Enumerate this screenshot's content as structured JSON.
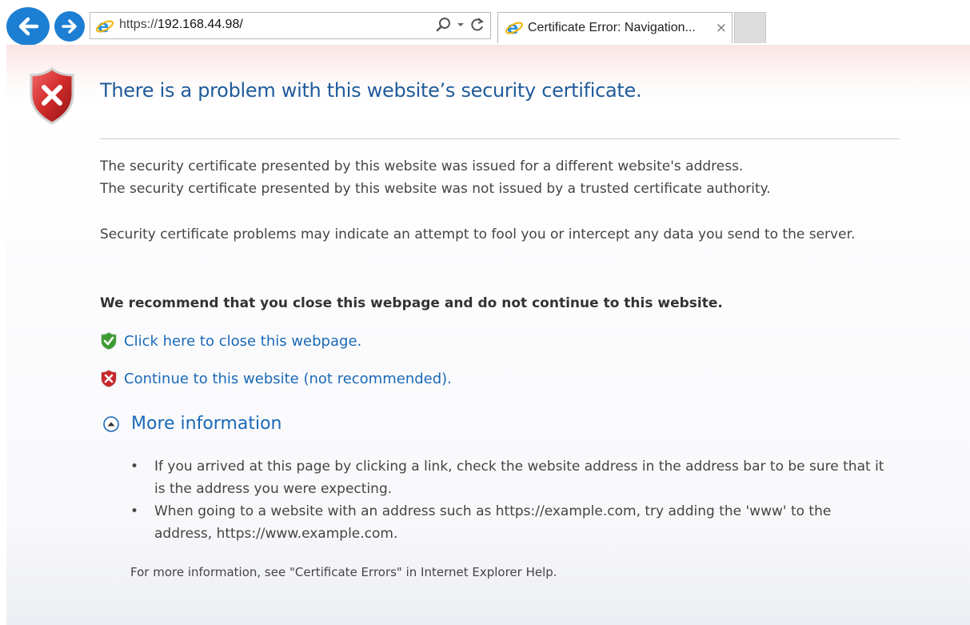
{
  "browser": {
    "url_prefix": "https://",
    "url_host": "192.168.44.98/",
    "tab_title": "Certificate Error: Navigation...",
    "close_glyph": "×"
  },
  "page": {
    "title": "There is a problem with this website’s security certificate.",
    "lines": [
      "The security certificate presented by this website was issued for a different website's address.",
      "The security certificate presented by this website was not issued by a trusted certificate authority."
    ],
    "warning": "Security certificate problems may indicate an attempt to fool you or intercept any data you send to the server.",
    "recommend": "We recommend that you close this webpage and do not continue to this website.",
    "close_link": "Click here to close this webpage.",
    "continue_link": "Continue to this website (not recommended).",
    "more_info": "More information",
    "bullets": [
      "If you arrived at this page by clicking a link, check the website address in the address bar to be sure that it is the address you were expecting.",
      "When going to a website with an address such as https://example.com, try adding the 'www' to the address, https://www.example.com."
    ],
    "bullet_glyph": "•",
    "help": "For more information, see \"Certificate Errors\" in Internet Explorer Help."
  },
  "colors": {
    "nav_blue": "#1d7fd3",
    "title_blue": "#1f5b9a",
    "link_blue": "#1a69b7",
    "shield_red": "#c8272b",
    "shield_green": "#3f9c35"
  },
  "icons": {
    "back": "back-arrow-icon",
    "forward": "forward-arrow-icon",
    "ie": "ie-logo-icon",
    "search": "search-icon",
    "refresh": "refresh-icon",
    "error_shield": "error-shield-icon",
    "safe_shield": "safe-shield-icon",
    "collapse": "collapse-icon"
  }
}
